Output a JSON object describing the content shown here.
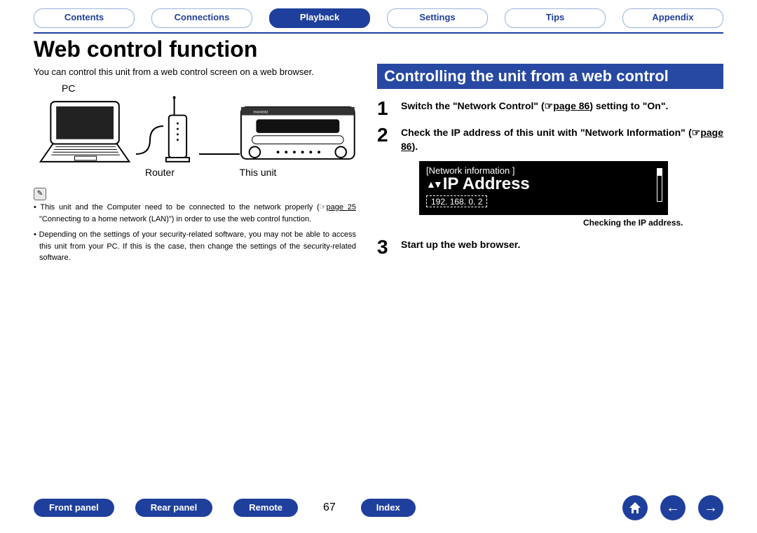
{
  "tabs": {
    "contents": "Contents",
    "connections": "Connections",
    "playback": "Playback",
    "settings": "Settings",
    "tips": "Tips",
    "appendix": "Appendix"
  },
  "title": "Web control function",
  "intro": "You can control this unit from a web control screen on a web browser.",
  "diagram": {
    "pc": "PC",
    "router": "Router",
    "unit": "This unit"
  },
  "notes": {
    "n1a": "This unit and the Computer need to be connected to the network properly (",
    "n1link": "page 25",
    "n1b": " \"Connecting to a home network (LAN)\") in order to use the web control function.",
    "n2": "Depending on the settings of your security-related software, you may not be able to access this unit from your PC. If this is the case, then change the settings of the security-related software."
  },
  "section": "Controlling the unit from a web control",
  "steps": {
    "s1": {
      "num": "1",
      "a": "Switch the \"Network Control\" (",
      "link": "page 86",
      "b": ") setting to \"On\"."
    },
    "s2": {
      "num": "2",
      "a": "Check the IP address of this unit with \"Network Information\" (",
      "link": "page 86",
      "b": ")."
    },
    "s3": {
      "num": "3",
      "text": "Start up the web browser."
    }
  },
  "display": {
    "header": "[Network information ]",
    "label": "IP Address",
    "ip": "192. 168. 0. 2",
    "caption": "Checking the IP address."
  },
  "footer": {
    "front": "Front panel",
    "rear": "Rear panel",
    "remote": "Remote",
    "page": "67",
    "index": "Index"
  }
}
